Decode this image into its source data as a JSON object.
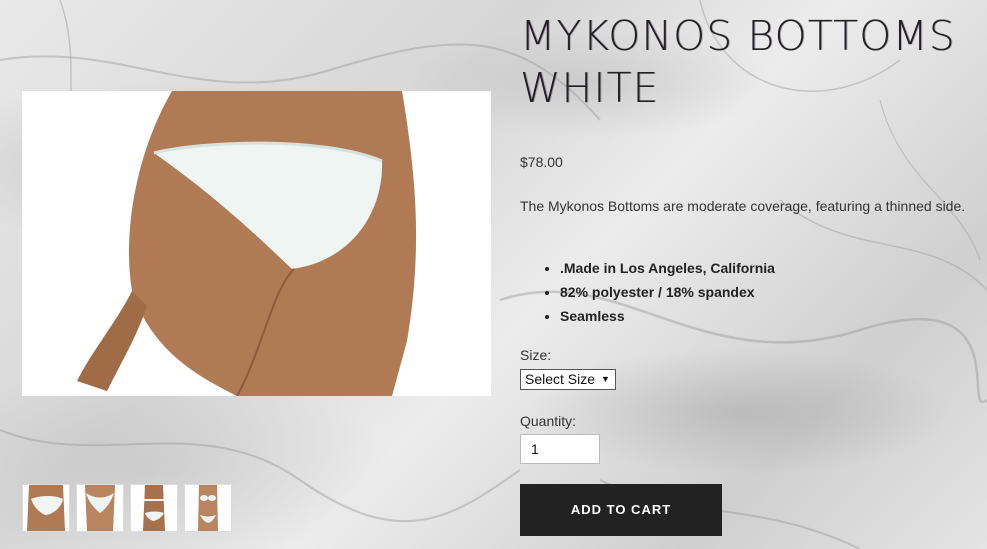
{
  "product": {
    "title": "MYKONOS BOTTOMS WHITE",
    "price": "$78.00",
    "description": "The Mykonos Bottoms are moderate coverage, featuring a thinned side.",
    "features": [
      ".Made in Los Angeles, California",
      "82% polyester / 18% spandex",
      "Seamless"
    ]
  },
  "form": {
    "size_label": "Size:",
    "size_selected": "Select Size",
    "quantity_label": "Quantity:",
    "quantity_value": "1",
    "add_to_cart_label": "ADD TO CART"
  },
  "gallery": {
    "main_image": "bikini-bottom-back-view",
    "thumbnails": [
      "bottom-back-view",
      "bottom-front-view",
      "bikini-back-full",
      "bikini-front-full"
    ]
  },
  "colors": {
    "button_bg": "#222222",
    "button_text": "#ffffff"
  }
}
